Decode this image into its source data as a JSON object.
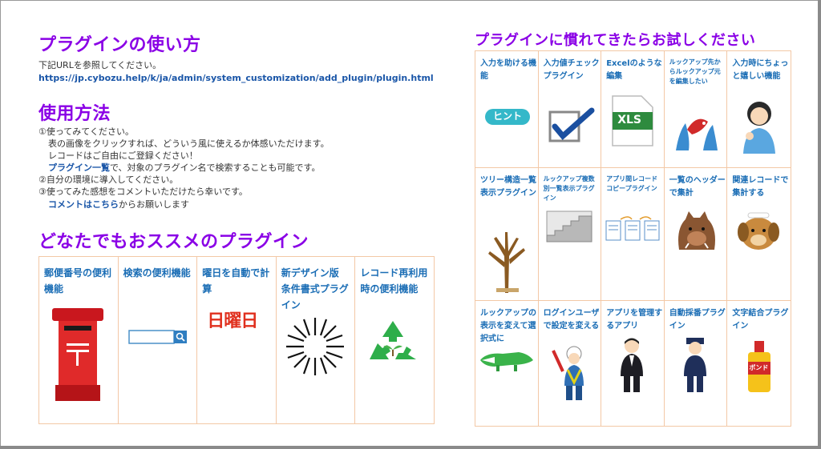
{
  "left": {
    "usage_title": "プラグインの使い方",
    "usage_line": "下記URLを参照してください。",
    "usage_url": "https://jp.cybozu.help/k/ja/admin/system_customization/add_plugin/plugin.html",
    "how_title": "使用方法",
    "step1": "①使ってみてください。",
    "step1a": "表の画像をクリックすれば、どういう風に使えるか体感いただけます。",
    "step1b": "レコードはご自由にご登録ください！",
    "step1c_link": "プラグイン一覧",
    "step1c_rest": "で、対象のプラグイン名で検索することも可能です。",
    "step2": "②自分の環境に導入してください。",
    "step3": "③使ってみた感想をコメントいただけたら幸いです。",
    "comment_link1": "コメントは",
    "comment_link2": "こちら",
    "comment_rest": "からお願いします",
    "rec_title": "どなたでもおススメのプラグイン",
    "rec_items": [
      {
        "label": "郵便番号の便利機能"
      },
      {
        "label": "検索の便利機能"
      },
      {
        "label": "曜日を自動で計算"
      },
      {
        "label": "新デザイン版 条件書式プラグイン"
      },
      {
        "label": "レコード再利用時の便利機能"
      }
    ],
    "youbi_text": "日曜日"
  },
  "right": {
    "title": "プラグインに慣れてきたらお試しください",
    "items": [
      {
        "label": "入力を助ける機能"
      },
      {
        "label": "入力値チェックプラグイン"
      },
      {
        "label": "Excelのような編集"
      },
      {
        "label": "ルックアップ先からルックアップ元を編集したい"
      },
      {
        "label": "入力時にちょっと嬉しい機能"
      },
      {
        "label": "ツリー構造一覧表示プラグイン"
      },
      {
        "label": "ルックアップ複数別一覧表示プラグイン"
      },
      {
        "label": "アプリ間レコードコピープラグイン"
      },
      {
        "label": "一覧のヘッダーで集計"
      },
      {
        "label": "関連レコードで集計する"
      },
      {
        "label": "ルックアップの表示を変えて選択式に"
      },
      {
        "label": "ログインユーザで設定を変える"
      },
      {
        "label": "アプリを管理するアプリ"
      },
      {
        "label": "自動採番プラグイン"
      },
      {
        "label": "文字結合プラグイン"
      }
    ],
    "hint_text": "ヒント",
    "xls_text": "XLS",
    "bond_text": "ボンド"
  }
}
